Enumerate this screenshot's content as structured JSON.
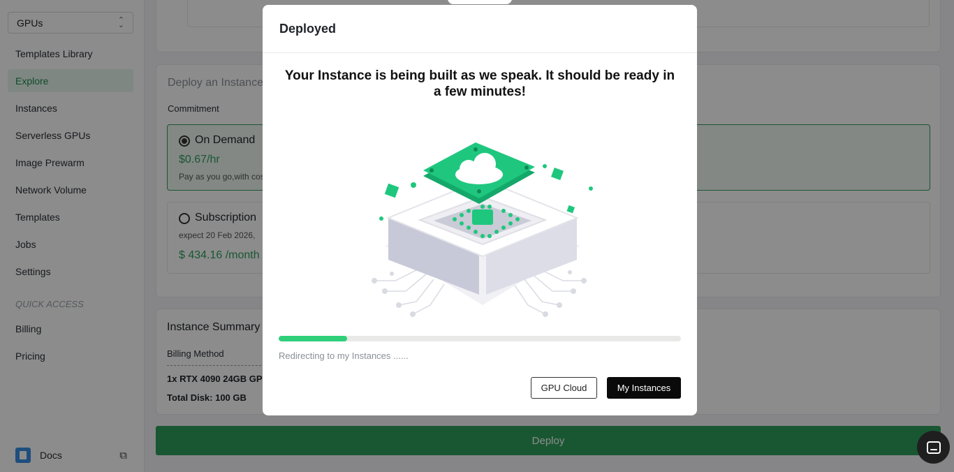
{
  "sidebar": {
    "workspace_select": "GPUs",
    "items": [
      {
        "label": "Templates Library"
      },
      {
        "label": "Explore"
      },
      {
        "label": "Instances"
      },
      {
        "label": "Serverless GPUs"
      },
      {
        "label": "Image Prewarm"
      },
      {
        "label": "Network Volume"
      },
      {
        "label": "Templates"
      },
      {
        "label": "Jobs"
      },
      {
        "label": "Settings"
      }
    ],
    "quick_access_label": "QUICK ACCESS",
    "quick_items": [
      {
        "label": "Billing"
      },
      {
        "label": "Pricing"
      }
    ],
    "docs_label": "Docs"
  },
  "main": {
    "deploy_section": {
      "title": "Deploy an Instance",
      "commitment_label": "Commitment",
      "on_demand": {
        "name": "On Demand",
        "price": "$0.67/hr",
        "desc": "Pay as you go,with cos"
      },
      "subscription": {
        "name": "Subscription",
        "expect": "expect  20 Feb 2026,",
        "price": "$ 434.16 /month"
      }
    },
    "summary": {
      "title": "Instance Summary",
      "billing_method_label": "Billing Method",
      "gpu_line": "1x RTX 4090 24GB GPU",
      "disk_line": "Total Disk: 100 GB"
    },
    "deploy_button": "Deploy"
  },
  "modal": {
    "title": "Deployed",
    "message": "Your Instance is being built as we speak. It should be ready in a few minutes!",
    "progress": 0.17,
    "redirect_text": "Redirecting to my Instances ......",
    "secondary_button": "GPU Cloud",
    "primary_button": "My Instances"
  },
  "colors": {
    "accent_green": "#2e9e5b",
    "progress_green": "#2fcf7a",
    "illustration_green": "#1fc77e"
  }
}
